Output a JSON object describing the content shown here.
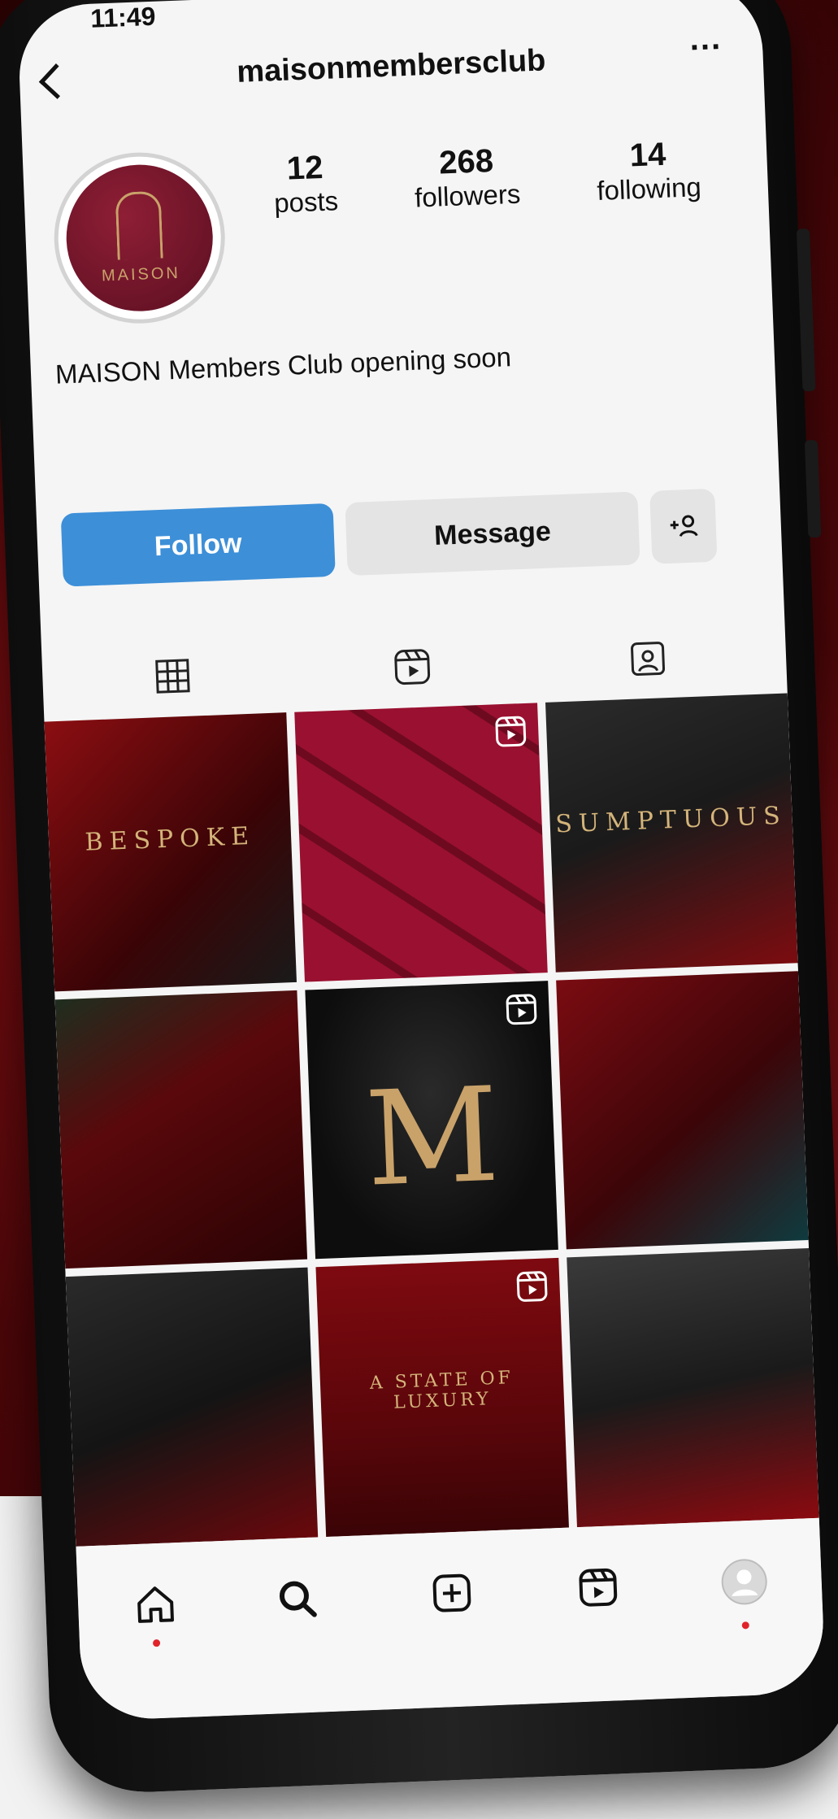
{
  "status_bar": {
    "time": "11:49"
  },
  "header": {
    "username": "maisonmembersclub",
    "more_label": "..."
  },
  "profile": {
    "avatar_text": "MAISON",
    "stats": [
      {
        "value": "12",
        "label": "posts"
      },
      {
        "value": "268",
        "label": "followers"
      },
      {
        "value": "14",
        "label": "following"
      }
    ],
    "bio": "MAISON Members Club opening soon"
  },
  "actions": {
    "follow": "Follow",
    "message": "Message",
    "add_user_icon": "+ person"
  },
  "tabs": [
    "grid-icon",
    "reels-icon",
    "tagged-icon"
  ],
  "posts": [
    {
      "title": "BESPOKE",
      "reel": false
    },
    {
      "title": "",
      "reel": true
    },
    {
      "title": "SUMPTUOUS",
      "reel": false
    },
    {
      "title": "",
      "reel": false
    },
    {
      "title": "M",
      "reel": true
    },
    {
      "title": "",
      "reel": false
    },
    {
      "title": "",
      "reel": false
    },
    {
      "title": "A STATE OF LUXURY",
      "reel": true
    },
    {
      "title": "",
      "reel": false
    }
  ],
  "bottom_nav": [
    "home-icon",
    "search-icon",
    "create-icon",
    "reels-icon",
    "profile-icon"
  ],
  "colors": {
    "follow_button": "#3d8fd8",
    "accent_gold": "#c9a26a",
    "notification_dot": "#e0242a"
  }
}
